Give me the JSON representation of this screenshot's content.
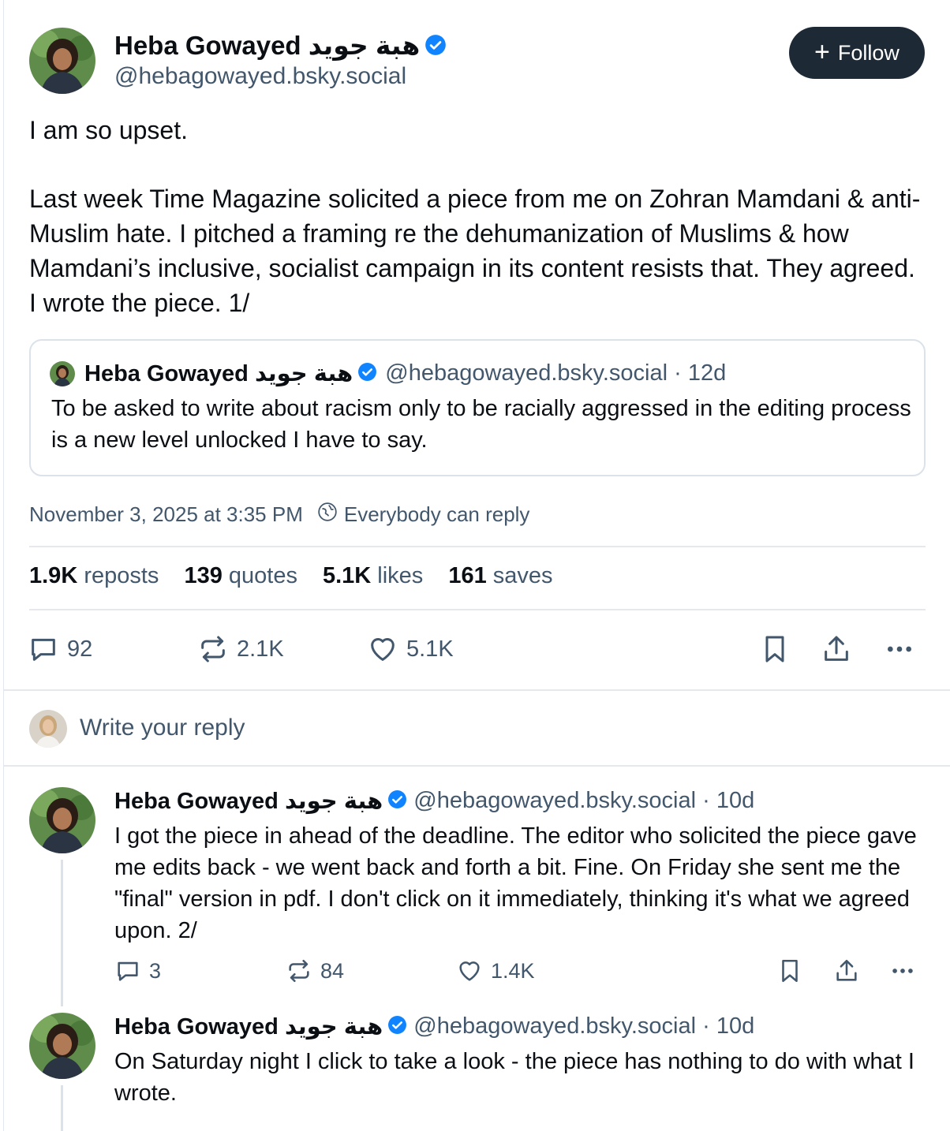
{
  "main_post": {
    "author_name": "Heba Gowayed هبة جويد",
    "handle": "@hebagowayed.bsky.social",
    "follow_label": "Follow",
    "text_line1": "I am so upset.",
    "text_para2": "Last week Time Magazine solicited a piece from me on Zohran Mamdani & anti-Muslim hate. I pitched a framing re the dehumanization of Muslims & how Mamdani’s inclusive, socialist campaign in its content resists that. They agreed. I wrote the piece. 1/",
    "quote": {
      "author_name": "Heba Gowayed هبة جويد",
      "handle_time": "@hebagowayed.bsky.social · 12d",
      "text": "To be asked to write about racism only to be racially aggressed in the editing process is a new level unlocked I have to say."
    },
    "timestamp": "November 3, 2025 at 3:35 PM",
    "reply_permission": "Everybody can reply",
    "stats": [
      {
        "count": "1.9K",
        "label": "reposts"
      },
      {
        "count": "139",
        "label": "quotes"
      },
      {
        "count": "5.1K",
        "label": "likes"
      },
      {
        "count": "161",
        "label": "saves"
      }
    ],
    "actions": {
      "replies": "92",
      "reposts": "2.1K",
      "likes": "5.1K"
    }
  },
  "composer": {
    "placeholder": "Write your reply"
  },
  "replies": [
    {
      "author_name": "Heba Gowayed هبة جويد",
      "handle_time": "@hebagowayed.bsky.social · 10d",
      "text": "I got the piece in ahead of the deadline. The editor who solicited the piece gave me edits back - we went back and forth a bit. Fine. On Friday she sent me the \"final\" version in pdf. I don't click on it immediately, thinking it's what we agreed upon.  2/",
      "actions": {
        "replies": "3",
        "reposts": "84",
        "likes": "1.4K"
      }
    },
    {
      "author_name": "Heba Gowayed هبة جويد",
      "handle_time": "@hebagowayed.bsky.social · 10d",
      "text": "On Saturday night I click to take a look - the piece has nothing to do with what I wrote."
    }
  ],
  "colors": {
    "verified": "#1083fe",
    "follow_bg": "#1e2936",
    "muted": "#42576c"
  },
  "icons": [
    "verified-badge-icon",
    "plus-icon",
    "globe-reply-icon",
    "reply-icon",
    "repost-icon",
    "like-icon",
    "bookmark-icon",
    "share-icon",
    "more-icon"
  ]
}
